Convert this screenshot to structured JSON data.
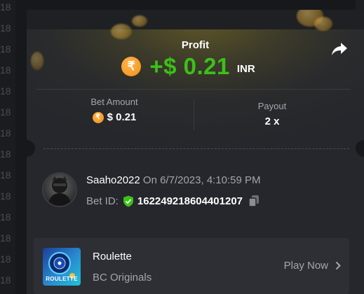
{
  "background": {
    "side_numbers": [
      "18",
      "18",
      "18",
      "18",
      "18",
      "18",
      "18",
      "18",
      "18",
      "18",
      "18",
      "18",
      "18",
      "18"
    ]
  },
  "profit": {
    "label": "Profit",
    "currency_icon": "rupee-coin-icon",
    "amount": "+$ 0.21",
    "currency": "INR",
    "amount_color": "#3bc117"
  },
  "stats": {
    "bet_amount_label": "Bet Amount",
    "bet_amount_value": "$ 0.21",
    "payout_label": "Payout",
    "payout_value": "2 x"
  },
  "user": {
    "name": "Saaho2022",
    "date": "On 6/7/2023, 4:10:59 PM",
    "bet_id_label": "Bet ID:",
    "bet_id": "162249218604401207"
  },
  "game": {
    "name": "Roulette",
    "provider": "BC Originals",
    "thumb_text": "ROULETTE",
    "action": "Play Now"
  }
}
